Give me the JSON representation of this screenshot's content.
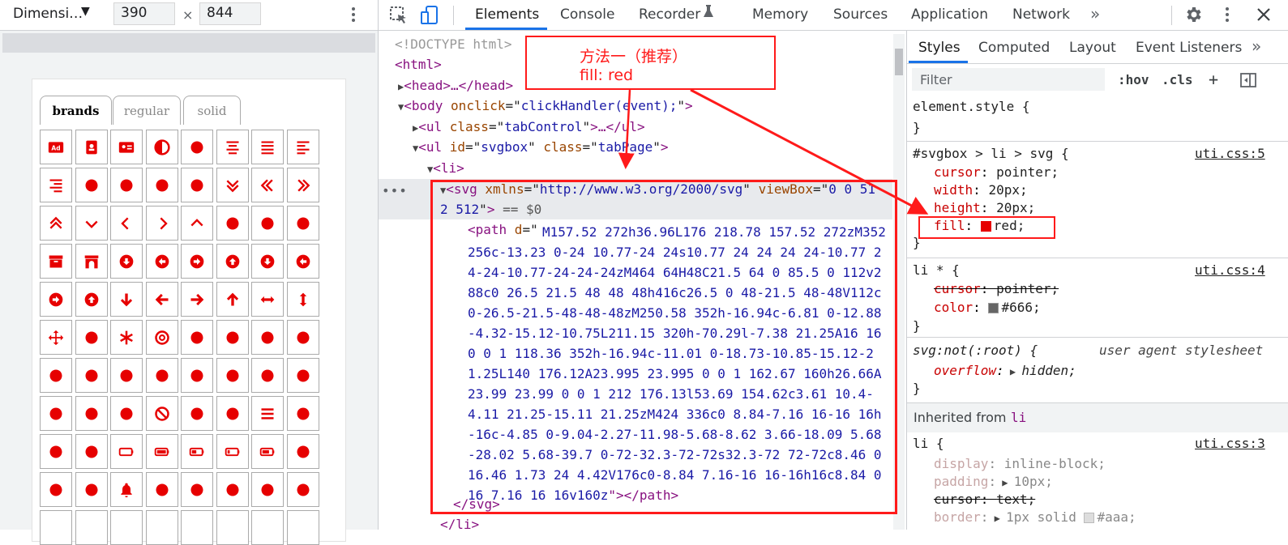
{
  "device_toolbar": {
    "device": "Dimensi…",
    "width": "390",
    "height": "844",
    "x": "×"
  },
  "demo_page": {
    "tabs": [
      "brands",
      "regular",
      "solid"
    ],
    "active_tab": "brands",
    "icon_color": "#e60000",
    "icon_rows": [
      [
        "ad-icon",
        "address-book-icon",
        "address-card-icon",
        "adjust-icon",
        "air-freshener-icon",
        "align-center-icon",
        "align-justify-icon",
        "align-left-icon"
      ],
      [
        "align-right-icon",
        "allergies-icon",
        "ambulance-icon",
        "american-sign-language-icon",
        "anchor-icon",
        "angle-double-down-icon",
        "angle-double-left-icon",
        "angle-double-right-icon"
      ],
      [
        "angle-double-up-icon",
        "angle-down-icon",
        "angle-left-icon",
        "angle-right-icon",
        "angle-up-icon",
        "angry-icon",
        "ankh-icon",
        "apple-alt-icon"
      ],
      [
        "archive-icon",
        "archway-icon",
        "arrow-alt-circle-down-icon",
        "arrow-alt-circle-left-icon",
        "arrow-alt-circle-right-icon",
        "arrow-alt-circle-up-icon",
        "arrow-circle-down-icon",
        "arrow-circle-left-icon"
      ],
      [
        "arrow-circle-right-icon",
        "arrow-circle-up-icon",
        "arrow-down-icon",
        "arrow-left-icon",
        "arrow-right-icon",
        "arrow-up-icon",
        "arrows-alt-h-icon",
        "arrows-alt-v-icon"
      ],
      [
        "arrows-alt-icon",
        "assistive-listening-icon",
        "asterisk-icon",
        "at-icon",
        "atlas-icon",
        "atom-icon",
        "audio-description-icon",
        "award-icon"
      ],
      [
        "baby-carriage-icon",
        "baby-icon",
        "backspace-icon",
        "backward-icon",
        "bacon-icon",
        "bahai-icon",
        "bacteria-icon",
        "bacterium-icon"
      ],
      [
        "balance-scale-icon",
        "balance-scale-left-icon",
        "balance-scale-right-icon",
        "ban-icon",
        "band-aid-icon",
        "barcode-icon",
        "bars-icon",
        "baseball-ball-icon"
      ],
      [
        "basketball-ball-icon",
        "bath-icon",
        "battery-empty-icon",
        "battery-full-icon",
        "battery-half-icon",
        "battery-quarter-icon",
        "battery-three-quarters-icon",
        "bed-icon"
      ],
      [
        "beer-icon",
        "bell-slash-icon",
        "bell-icon",
        "bezier-curve-icon",
        "bible-icon",
        "bicycle-icon",
        "biking-icon",
        "binoculars-icon"
      ],
      [
        "cell-icon",
        "cell-icon",
        "cell-icon",
        "cell-icon",
        "cell-icon",
        "cell-icon",
        "cell-icon",
        "cell-icon"
      ]
    ]
  },
  "main_tabs": [
    "Elements",
    "Console",
    "Recorder",
    "Memory",
    "Sources",
    "Application",
    "Network"
  ],
  "more_tabs": "»",
  "elements": {
    "doctype": "<!DOCTYPE html>",
    "html_open": "<html>",
    "head": "<head>…</head>",
    "body_tag": "body",
    "body_attr": "onclick",
    "body_val": "clickHandler(event);",
    "ul1_attr": "class",
    "ul1_val": "tabControl",
    "ul1_tail": "…</ul>",
    "ul2_attr1": "id",
    "ul2_val1": "svgbox",
    "ul2_attr2": "class",
    "ul2_val2": "tabPage",
    "li_open": "<li>",
    "svg_attr1": "xmlns",
    "svg_val1": "http://www.w3.org/2000/svg",
    "svg_attr2": "viewBox",
    "svg_val2_a": "0 0 51",
    "svg_val2_b": "2 512",
    "selected_marker": "== $0",
    "path_attr": "d",
    "path_value": "M157.52 272h36.96L176 218.78 157.52 272zM352 256c-13.23 0-24 10.77-24 24s10.77 24 24 24 24-10.77 24-24-10.77-24-24-24zM464 64H48C21.5 64 0 85.5 0 112v288c0 26.5 21.5 48 48 48h416c26.5 0 48-21.5 48-48V112c0-26.5-21.5-48-48-48zM250.58 352h-16.94c-6.81 0-12.88-4.32-15.12-10.75L211.15 320h-70.29l-7.38 21.25A16 16 0 0 1 118.36 352h-16.94c-11.01 0-18.73-10.85-15.12-21.25L140 176.12A23.995 23.995 0 0 1 162.67 160h26.66A23.99 23.99 0 0 1 212 176.13l53.69 154.62c3.61 10.4-4.11 21.25-15.11 21.25zM424 336c0 8.84-7.16 16-16 16h-16c-4.85 0-9.04-2.27-11.98-5.68-8.62 3.66-18.09 5.68-28.02 5.68-39.7 0-72-32.3-72-72s32.3-72 72-72c8.46 0 16.46 1.73 24 4.42V176c0-8.84 7.16-16 16-16h16c8.84 0 16 7.16 16 16v160z",
    "path_close": "\"></path>",
    "svg_close": "</svg>",
    "li_close": "</li>"
  },
  "annotation": {
    "line1": "方法一（推荐）",
    "line2": "fill: red",
    "color": "#ff1a1a"
  },
  "styles": {
    "tabs": [
      "Styles",
      "Computed",
      "Layout",
      "Event Listeners"
    ],
    "more": "»",
    "filter_placeholder": "Filter",
    "hov": ":hov",
    "cls": ".cls",
    "plus": "+",
    "element_style": "element.style {",
    "close": "}",
    "rule1": {
      "selector": "#svgbox > li > svg {",
      "source": "uti.css:5",
      "props": [
        [
          "cursor",
          "pointer;"
        ],
        [
          "width",
          "20px;"
        ],
        [
          "height",
          "20px;"
        ],
        [
          "fill",
          "red;"
        ]
      ]
    },
    "rule2": {
      "selector": "li * {",
      "source": "uti.css:4",
      "props": [
        [
          "cursor",
          "pointer;"
        ],
        [
          "color",
          "#666;"
        ]
      ]
    },
    "rule3": {
      "selector": "svg:not(:root) {",
      "source": "user agent stylesheet",
      "props": [
        [
          "overflow",
          "hidden;"
        ]
      ]
    },
    "inherited_label": "Inherited from",
    "inherited_tag": "li",
    "rule4": {
      "selector": "li {",
      "source": "uti.css:3",
      "props": [
        [
          "display",
          "inline-block;"
        ],
        [
          "padding",
          "10px;"
        ],
        [
          "cursor",
          "text;"
        ],
        [
          "border",
          "1px solid"
        ]
      ],
      "border_color": "#aaa;"
    },
    "swatch_red": "#e60000",
    "swatch_grey": "#666666",
    "swatch_light": "#aaaaaa"
  }
}
